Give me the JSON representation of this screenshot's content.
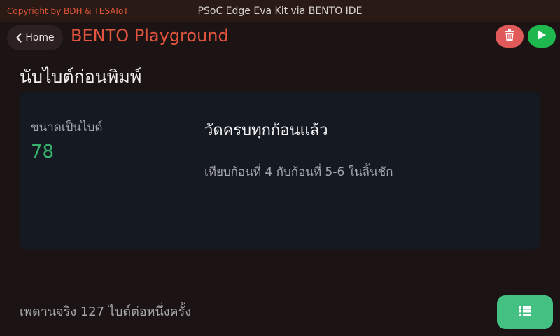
{
  "header": {
    "copyright": "Copyright by BDH & TESAIoT",
    "window_title": "PSoC Edge Eva Kit via BENTO IDE"
  },
  "nav": {
    "home_label": "Home",
    "app_title": "BENTO Playground"
  },
  "icons": {
    "back": "chevron-left-icon",
    "delete": "trash-icon",
    "run": "play-icon",
    "list": "table-list-icon"
  },
  "colors": {
    "accent": "#e4553e",
    "delete": "#e05a5a",
    "run": "#1fb84f",
    "value": "#36b46e",
    "list_button": "#44c082"
  },
  "main": {
    "heading": "นับไบต์ก่อนพิมพ์",
    "card": {
      "metric_label": "ขนาดเป็นไบต์",
      "metric_value": "78",
      "status": "วัดครบทุกก้อนแล้ว",
      "detail": "เทียบก้อนที่ 4 กับก้อนที่ 5-6 ในลิ้นชัก"
    },
    "footer_note": "เพดานจริง 127 ไบต์ต่อหนึ่งครั้ง"
  }
}
